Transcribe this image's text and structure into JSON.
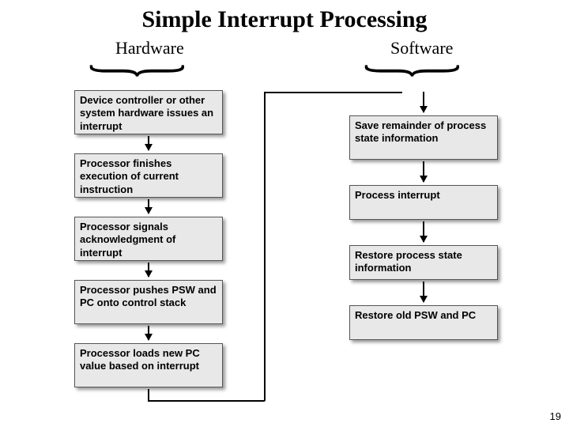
{
  "title": "Simple Interrupt Processing",
  "sections": {
    "hardware": "Hardware",
    "software": "Software"
  },
  "hardware_steps": [
    "Device controller or other system hardware issues an interrupt",
    "Processor finishes execution of current instruction",
    "Processor signals acknowledgment of interrupt",
    "Processor pushes PSW and PC onto control stack",
    "Processor loads new PC value based on interrupt"
  ],
  "software_steps": [
    "Save remainder of process state information",
    "Process interrupt",
    "Restore process state information",
    "Restore old PSW and PC"
  ],
  "page_number": "19"
}
